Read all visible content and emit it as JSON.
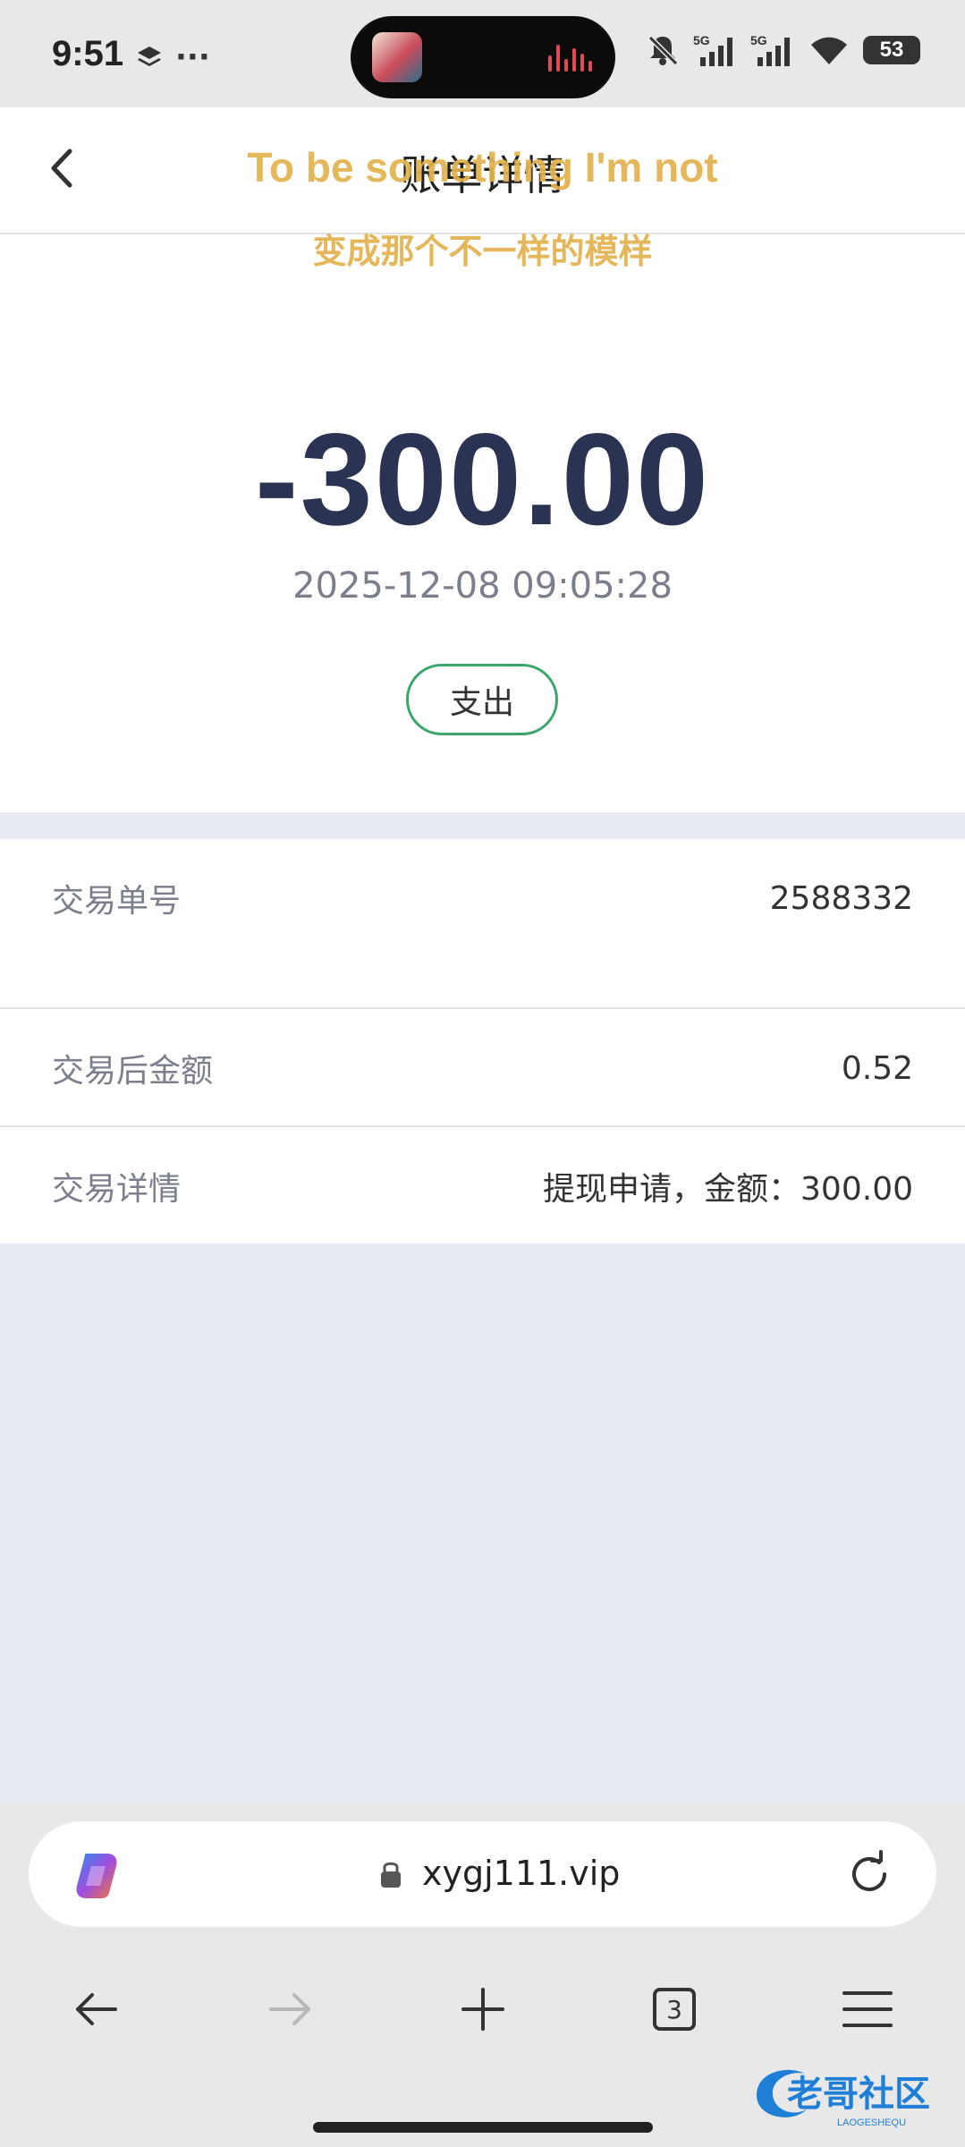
{
  "status_bar": {
    "time": "9:51",
    "more": "···",
    "battery": "53",
    "signal_labels": [
      "5G",
      "5G"
    ]
  },
  "header": {
    "title": "账单详情",
    "back_icon": "chevron-left-icon"
  },
  "overlay_lyrics": {
    "line1": "To be something I'm not",
    "line2": "变成那个不一样的模样"
  },
  "transaction": {
    "amount": "-300.00",
    "datetime": "2025-12-08 09:05:28",
    "type": "支出"
  },
  "details": [
    {
      "label": "交易单号",
      "value": "2588332"
    },
    {
      "label": "交易后金额",
      "value": "0.52"
    },
    {
      "label": "交易详情",
      "value": "提现申请，金额：300.00"
    }
  ],
  "browser": {
    "url": "xygj111.vip",
    "tab_count": "3"
  },
  "watermark": {
    "text": "老哥社区",
    "subtext": "LAOGESHEQU"
  },
  "colors": {
    "amount": "#2a3352",
    "badge_border": "#3aa66b",
    "lyrics": "#e2b34e",
    "page_bg": "#e9ebf2"
  }
}
